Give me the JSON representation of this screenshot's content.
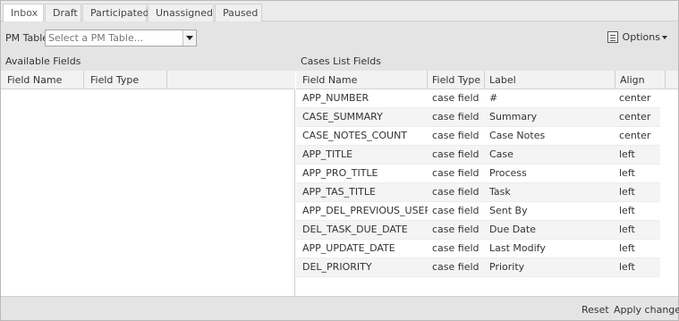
{
  "tabs": [
    {
      "label": "Inbox"
    },
    {
      "label": "Draft"
    },
    {
      "label": "Participated"
    },
    {
      "label": "Unassigned"
    },
    {
      "label": "Paused"
    }
  ],
  "toolbar": {
    "pm_table_label": "PM Table",
    "pm_table_placeholder": "Select a PM Table...",
    "options_label": "Options"
  },
  "available_fields": {
    "title": "Available Fields",
    "columns": [
      "Field Name",
      "Field Type"
    ],
    "rows": []
  },
  "cases_list_fields": {
    "title": "Cases List Fields",
    "columns": [
      "Field Name",
      "Field Type",
      "Label",
      "Align"
    ],
    "rows": [
      [
        "APP_NUMBER",
        "case field",
        "#",
        "center"
      ],
      [
        "CASE_SUMMARY",
        "case field",
        "Summary",
        "center"
      ],
      [
        "CASE_NOTES_COUNT",
        "case field",
        "Case Notes",
        "center"
      ],
      [
        "APP_TITLE",
        "case field",
        "Case",
        "left"
      ],
      [
        "APP_PRO_TITLE",
        "case field",
        "Process",
        "left"
      ],
      [
        "APP_TAS_TITLE",
        "case field",
        "Task",
        "left"
      ],
      [
        "APP_DEL_PREVIOUS_USER",
        "case field",
        "Sent By",
        "left"
      ],
      [
        "DEL_TASK_DUE_DATE",
        "case field",
        "Due Date",
        "left"
      ],
      [
        "APP_UPDATE_DATE",
        "case field",
        "Last Modify",
        "left"
      ],
      [
        "DEL_PRIORITY",
        "case field",
        "Priority",
        "left"
      ]
    ]
  },
  "footer": {
    "reset_label": "Reset",
    "apply_label": "Apply changes"
  }
}
